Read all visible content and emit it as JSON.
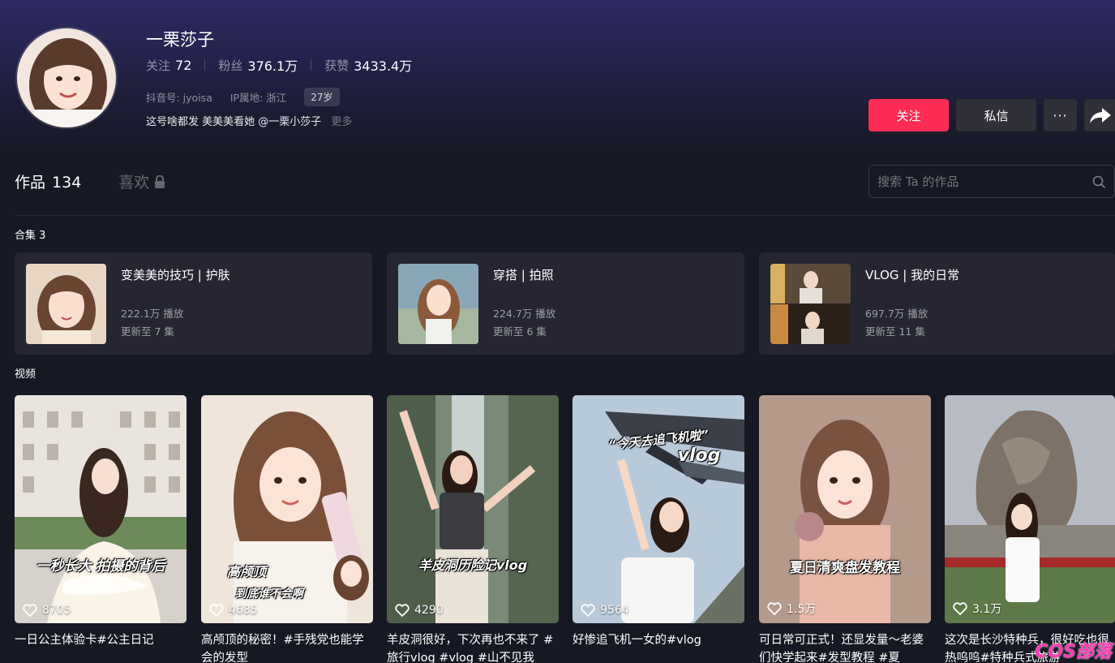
{
  "profile": {
    "name": "一栗莎子",
    "following_label": "关注",
    "following": "72",
    "followers_label": "粉丝",
    "followers": "376.1万",
    "likes_label": "获赞",
    "likes": "3433.4万",
    "douyin_id": "抖音号: jyoisa",
    "ip_location": "IP属地: 浙江",
    "age": "27岁",
    "bio": "这号啥都发 美美美看她 @一栗小莎子",
    "bio_more": "更多"
  },
  "actions": {
    "follow": "关注",
    "message": "私信",
    "more": "···"
  },
  "tabs": {
    "works_label": "作品",
    "works_count": "134",
    "likes_label": "喜欢"
  },
  "search": {
    "placeholder": "搜索 Ta 的作品"
  },
  "collections_section": "合集 3",
  "collections": [
    {
      "title": "变美美的技巧 | 护肤",
      "plays": "222.1万 播放",
      "updated": "更新至 7 集"
    },
    {
      "title": "穿搭 | 拍照",
      "plays": "224.7万 播放",
      "updated": "更新至 6 集"
    },
    {
      "title": "VLOG | 我的日常",
      "plays": "697.7万 播放",
      "updated": "更新至 11 集"
    }
  ],
  "videos_section": "视频",
  "videos": [
    {
      "likes": "8705",
      "caption": "一日公主体验卡#公主日记",
      "overlay": "一秒长大 拍摄的背后"
    },
    {
      "likes": "4685",
      "caption": "高颅顶的秘密！#手残党也能学会的发型",
      "overlay": "高颅顶",
      "overlay2": "到底谁不会啊"
    },
    {
      "likes": "4290",
      "caption": "羊皮洞很好，下次再也不来了 #旅行vlog #vlog #山不见我",
      "overlay": "羊皮洞历险记vlog"
    },
    {
      "likes": "9564",
      "caption": "好惨追飞机一女的#vlog",
      "overlay": "“今天去追飞机啦”",
      "overlay2": "vlog"
    },
    {
      "likes": "1.5万",
      "caption": "可日常可正式！还显发量～老婆们快学起来#发型教程 #夏",
      "overlay": "夏日清爽盘发教程"
    },
    {
      "likes": "3.1万",
      "caption": "这次是长沙特种兵，很好吃也很热呜呜#特种兵式旅游"
    }
  ],
  "watermark": "COS部落",
  "colors": {
    "background": "#161823",
    "follow_button": "#fe2c55",
    "secondary_button": "#2f3038",
    "card": "#252632"
  }
}
